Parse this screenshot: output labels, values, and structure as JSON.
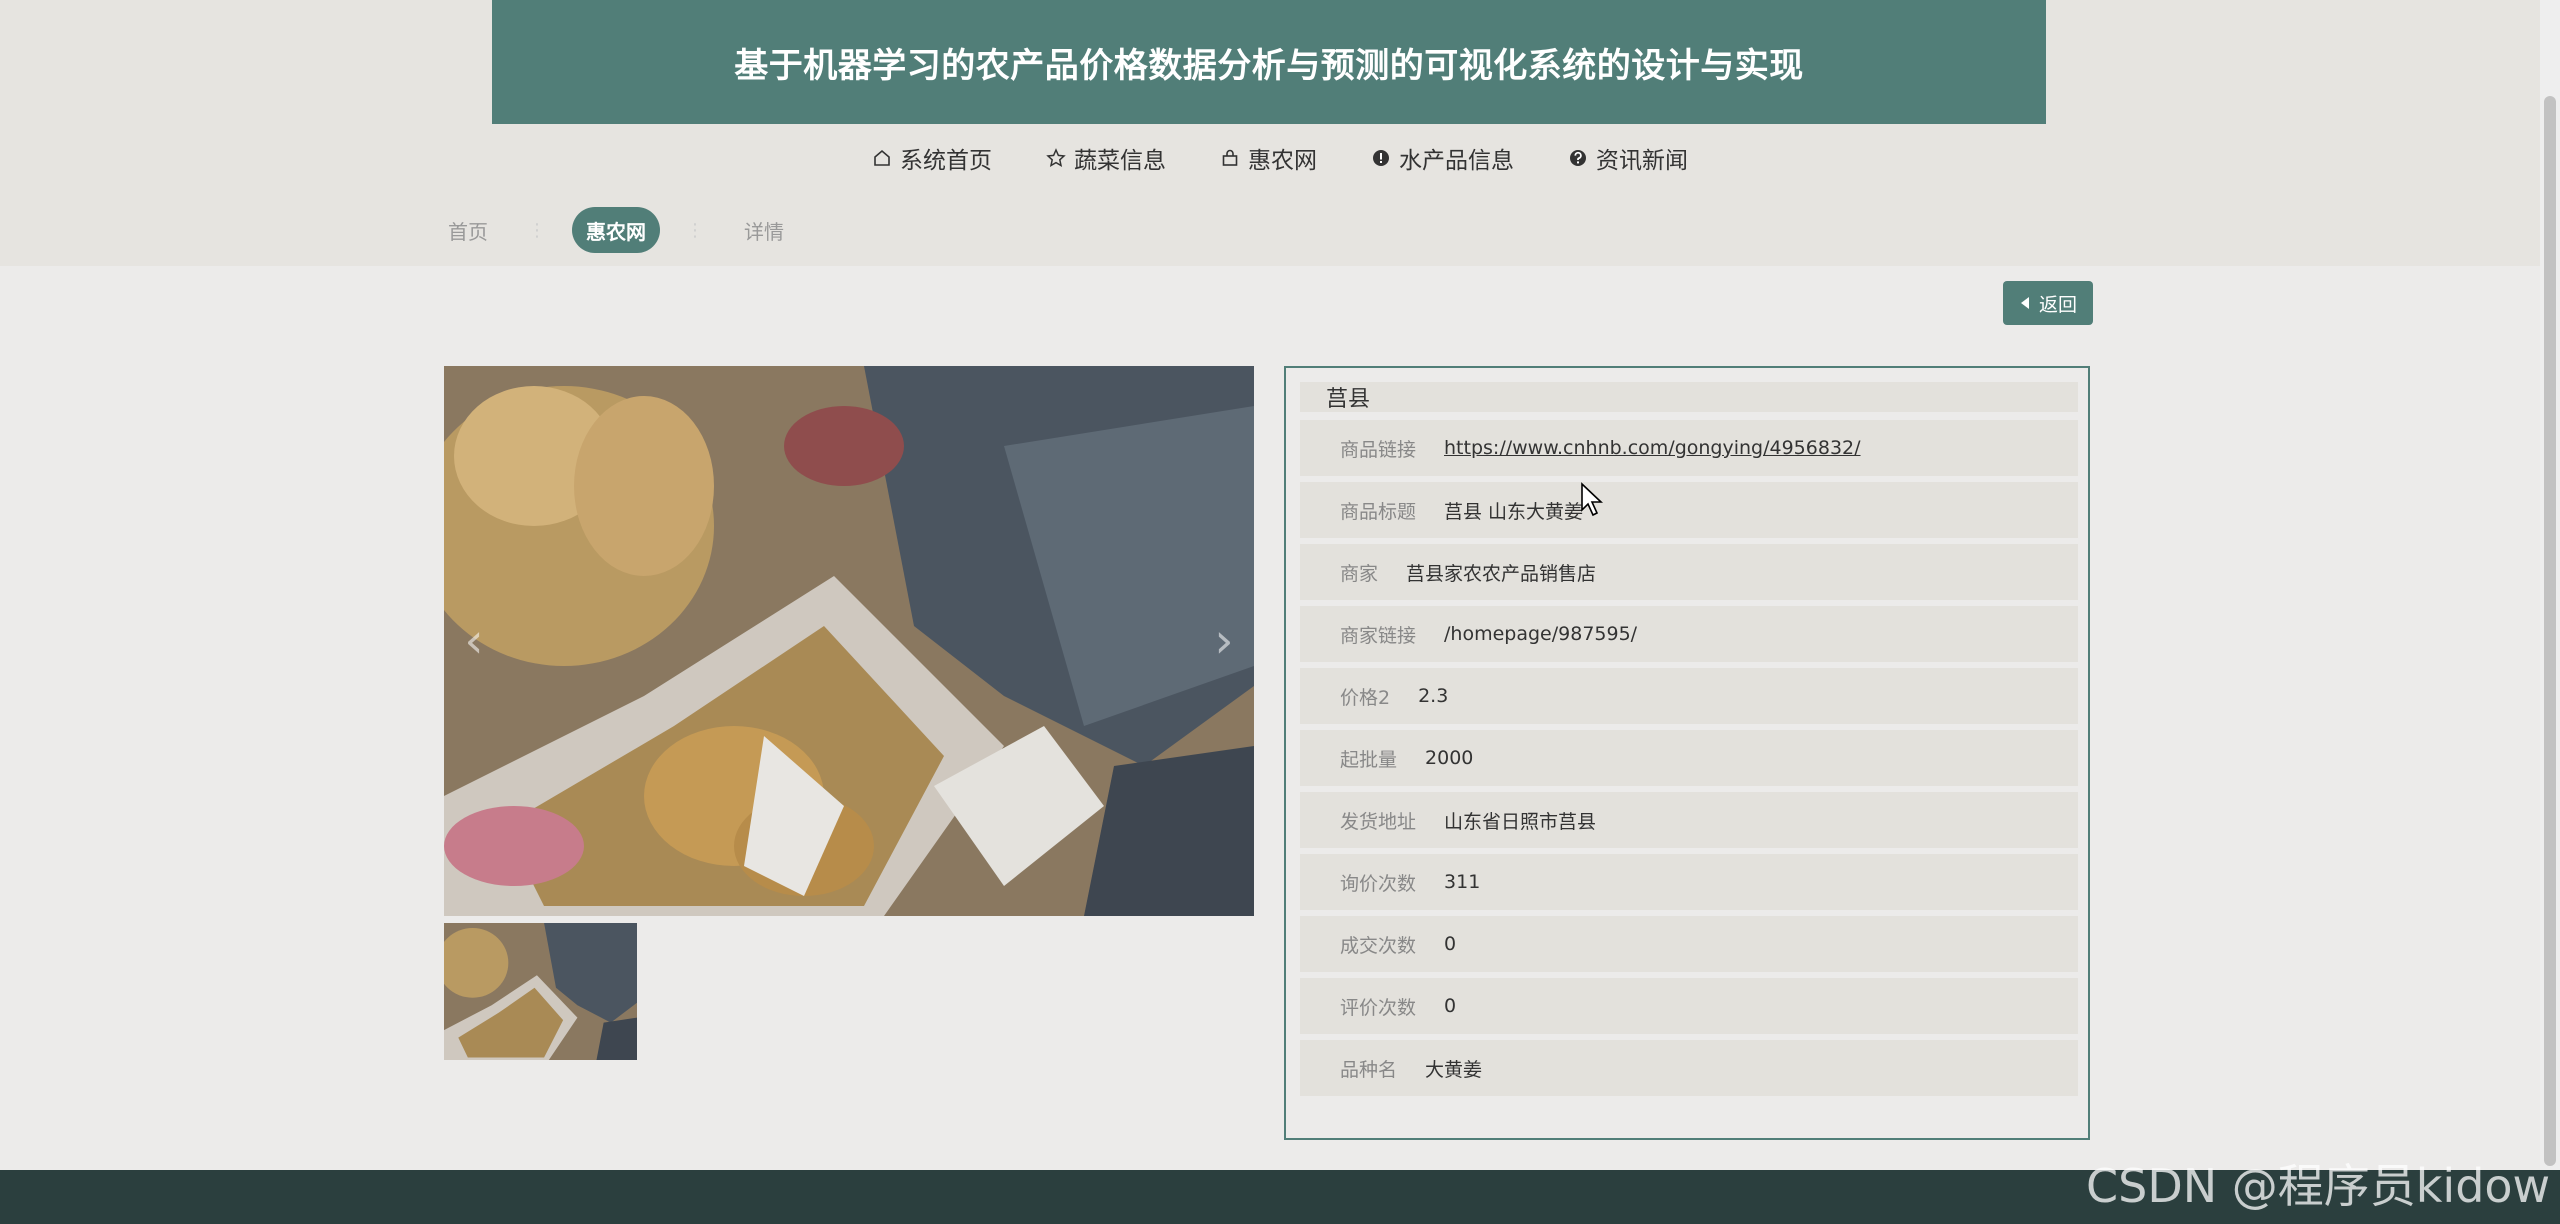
{
  "header": {
    "title": "基于机器学习的农产品价格数据分析与预测的可视化系统的设计与实现"
  },
  "nav": [
    {
      "label": "系统首页",
      "icon": "home-icon"
    },
    {
      "label": "蔬菜信息",
      "icon": "star-icon"
    },
    {
      "label": "惠农网",
      "icon": "bag-icon"
    },
    {
      "label": "水产品信息",
      "icon": "exclamation-icon"
    },
    {
      "label": "资讯新闻",
      "icon": "question-icon"
    }
  ],
  "breadcrumb": [
    "首页",
    "惠农网",
    "详情"
  ],
  "back_button": {
    "label": "返回"
  },
  "carousel": {
    "prev": "‹",
    "next": "›"
  },
  "detail": {
    "title": "莒县",
    "rows": [
      {
        "label": "商品链接",
        "value": "https://www.cnhnb.com/gongying/4956832/"
      },
      {
        "label": "商品标题",
        "value": "莒县 山东大黄姜"
      },
      {
        "label": "商家",
        "value": "莒县家农农产品销售店"
      },
      {
        "label": "商家链接",
        "value": "/homepage/987595/"
      },
      {
        "label": "价格2",
        "value": "2.3"
      },
      {
        "label": "起批量",
        "value": "2000"
      },
      {
        "label": "发货地址",
        "value": "山东省日照市莒县"
      },
      {
        "label": "询价次数",
        "value": "311"
      },
      {
        "label": "成交次数",
        "value": "0"
      },
      {
        "label": "评价次数",
        "value": "0"
      },
      {
        "label": "品种名",
        "value": "大黄姜"
      }
    ]
  },
  "watermark": "CSDN @程序员kidow",
  "colors": {
    "accent": "#517e78",
    "footer": "#2b3f3e"
  }
}
